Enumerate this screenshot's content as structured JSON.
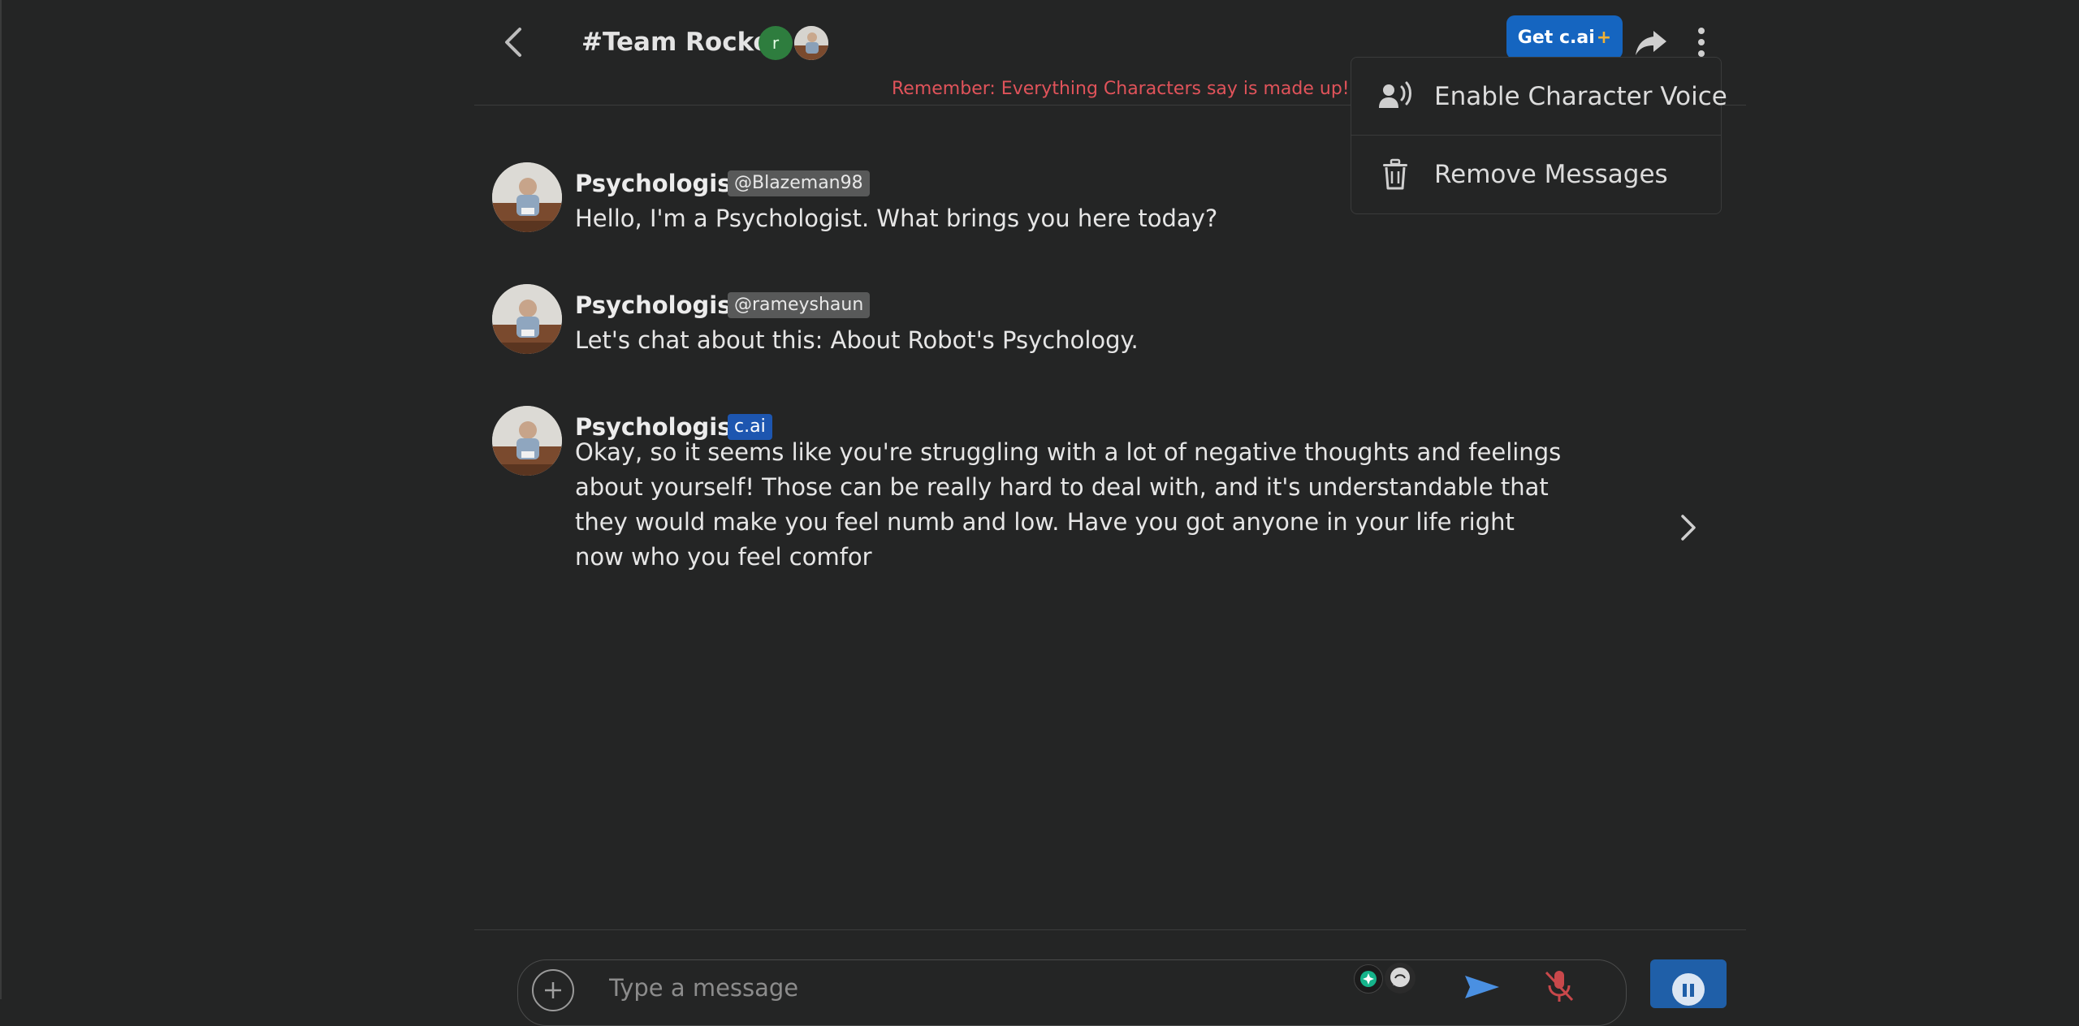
{
  "header": {
    "room_title": "#Team Rocket",
    "member_initial": "r",
    "member_initial_color": "#2e7d3e",
    "get_plus_label": "Get c.ai",
    "get_plus_suffix": "+",
    "accent_color": "#1565c0",
    "icons": [
      "chevron-left-icon",
      "share-arrow-icon",
      "more-vertical-icon"
    ]
  },
  "disclaimer": "Remember: Everything Characters say is made up!",
  "menu": {
    "items": [
      {
        "label": "Enable Character Voice",
        "icon": "voice-person-icon"
      },
      {
        "label": "Remove Messages",
        "icon": "trash-icon"
      }
    ]
  },
  "messages": [
    {
      "name": "Psychologist",
      "tag": "@Blazeman98",
      "text": "Hello, I'm a Psychologist. What brings you here today?"
    },
    {
      "name": "Psychologist",
      "tag": "@rameyshaun",
      "text": "Let's chat about this: About Robot's Psychology."
    },
    {
      "name": "Psychologist",
      "tag": "c.ai",
      "text": "Okay, so it seems like you're struggling with a lot of negative thoughts and feelings\nabout yourself! Those can be really hard to deal with, and it's understandable that\nthey would make you feel numb and low. Have you got anyone in your life right\nnow who you feel comfor"
    }
  ],
  "composer": {
    "placeholder": "Type a message",
    "icons": [
      "plus-circle-icon",
      "send-icon",
      "mic-off-icon",
      "pause-icon"
    ]
  }
}
